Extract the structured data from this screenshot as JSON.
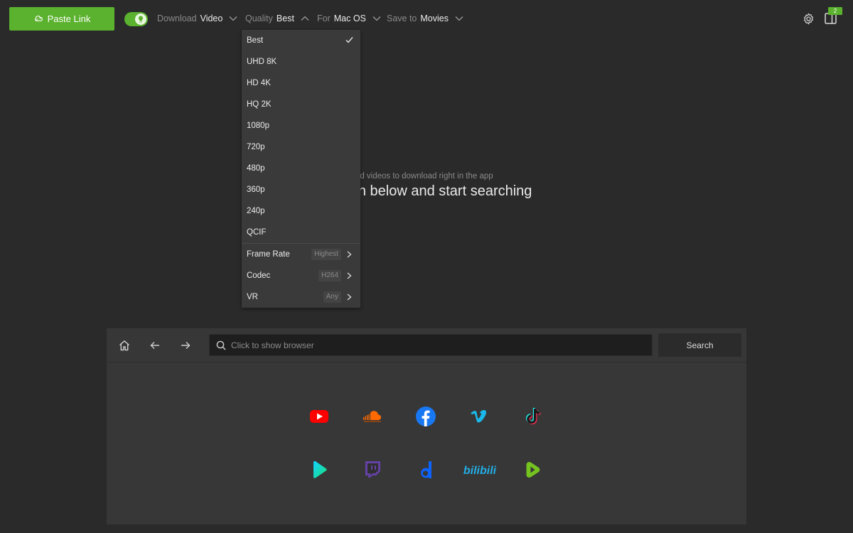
{
  "toolbar": {
    "paste_label": "Paste Link",
    "download_label": "Download",
    "download_value": "Video",
    "quality_label": "Quality",
    "quality_value": "Best",
    "for_label": "For",
    "for_value": "Mac OS",
    "save_label": "Save to",
    "save_value": "Movies",
    "badge_count": "2"
  },
  "center": {
    "subtitle": "d videos to download right in the app",
    "headline": "ce icon below and start searching"
  },
  "quality_menu": {
    "items": [
      {
        "label": "Best",
        "selected": true
      },
      {
        "label": "UHD 8K"
      },
      {
        "label": "HD 4K"
      },
      {
        "label": "HQ 2K"
      },
      {
        "label": "1080p"
      },
      {
        "label": "720p"
      },
      {
        "label": "480p"
      },
      {
        "label": "360p"
      },
      {
        "label": "240p"
      },
      {
        "label": "QCIF"
      }
    ],
    "submenus": [
      {
        "label": "Frame Rate",
        "value": "Highest"
      },
      {
        "label": "Codec",
        "value": "H264"
      },
      {
        "label": "VR",
        "value": "Any"
      }
    ]
  },
  "browser": {
    "search_placeholder": "Click to show browser",
    "search_button": "Search",
    "sites": [
      "youtube-icon",
      "soundcloud-icon",
      "facebook-icon",
      "vimeo-icon",
      "tiktok-icon",
      "dailymotion-play-icon",
      "twitch-icon",
      "dailymotion-icon",
      "bilibili-icon",
      "rumble-icon"
    ],
    "bilibili_text": "bilibili"
  },
  "colors": {
    "accent": "#5bb22e",
    "background": "#2a2a2a",
    "menu": "#3a3a3a",
    "panel": "#373737"
  }
}
